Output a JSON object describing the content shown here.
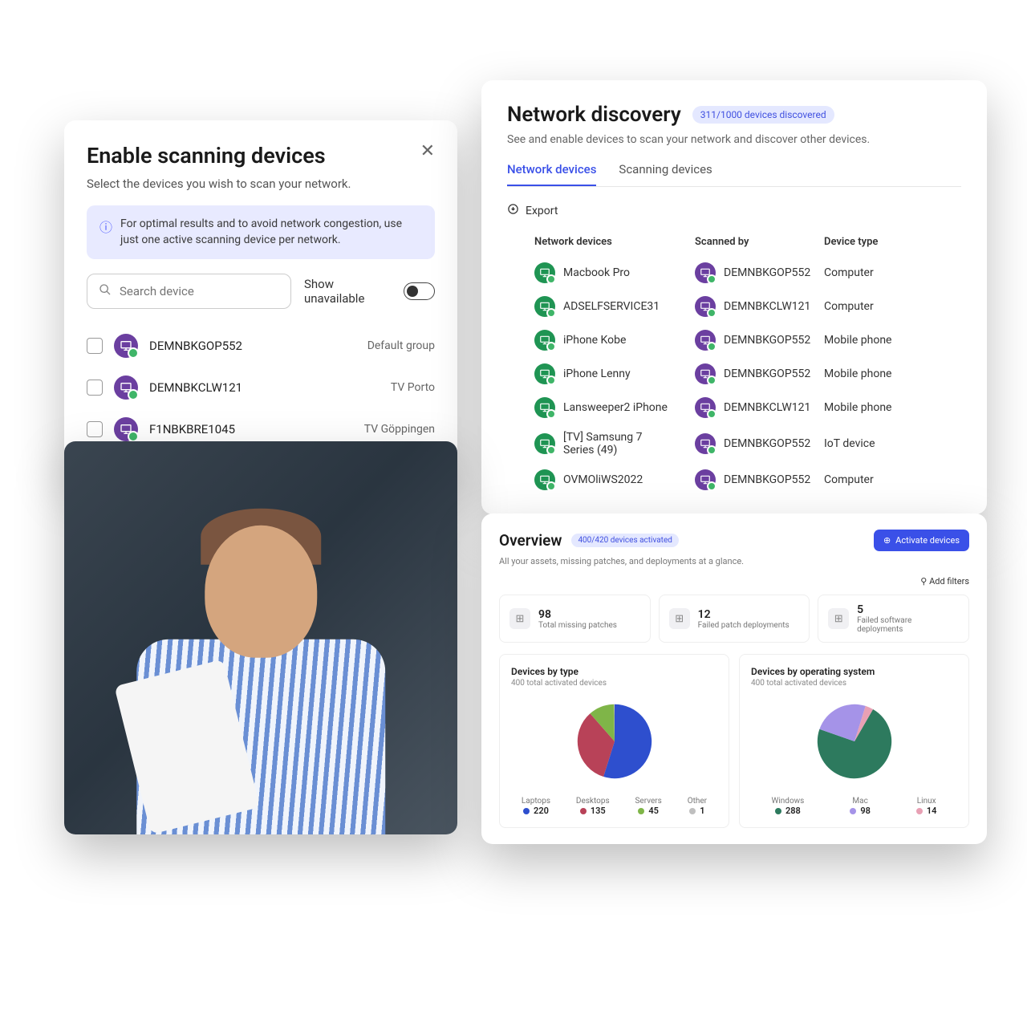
{
  "scanning": {
    "title": "Enable scanning devices",
    "subtitle": "Select the devices you wish to scan your network.",
    "info": "For optimal results and to avoid network congestion, use just one active scanning device per network.",
    "search_placeholder": "Search device",
    "show_unavailable": "Show unavailable",
    "devices": [
      {
        "name": "DEMNBKGOP552",
        "group": "Default group"
      },
      {
        "name": "DEMNBKCLW121",
        "group": "TV Porto"
      },
      {
        "name": "F1NBKBRE1045",
        "group": "TV Göppingen"
      }
    ]
  },
  "discovery": {
    "title": "Network discovery",
    "badge": "311/1000 devices discovered",
    "subtitle": "See and enable devices to scan your network and discover other devices.",
    "tabs": [
      "Network devices",
      "Scanning devices"
    ],
    "export": "Export",
    "columns": [
      "Network devices",
      "Scanned by",
      "Device type"
    ],
    "rows": [
      {
        "device": "Macbook Pro",
        "scanned": "DEMNBKGOP552",
        "type": "Computer"
      },
      {
        "device": "ADSELFSERVICE31",
        "scanned": "DEMNBKCLW121",
        "type": "Computer"
      },
      {
        "device": "iPhone Kobe",
        "scanned": "DEMNBKGOP552",
        "type": "Mobile phone"
      },
      {
        "device": "iPhone Lenny",
        "scanned": "DEMNBKGOP552",
        "type": "Mobile phone"
      },
      {
        "device": "Lansweeper2 iPhone",
        "scanned": "DEMNBKCLW121",
        "type": "Mobile phone"
      },
      {
        "device": "[TV] Samsung 7 Series (49)",
        "scanned": "DEMNBKGOP552",
        "type": "IoT device"
      },
      {
        "device": "OVMOliWS2022",
        "scanned": "DEMNBKGOP552",
        "type": "Computer"
      }
    ]
  },
  "overview": {
    "title": "Overview",
    "badge": "400/420 devices activated",
    "button": "Activate devices",
    "subtitle": "All your assets, missing patches, and deployments at a glance.",
    "filters": "Add filters",
    "stats": [
      {
        "value": "98",
        "label": "Total missing patches"
      },
      {
        "value": "12",
        "label": "Failed patch deployments"
      },
      {
        "value": "5",
        "label": "Failed software deployments"
      }
    ],
    "chart1": {
      "title": "Devices by type",
      "subtitle": "400 total activated devices",
      "items": [
        {
          "label": "Laptops",
          "value": 220,
          "color": "#2e4fce"
        },
        {
          "label": "Desktops",
          "value": 135,
          "color": "#b84258"
        },
        {
          "label": "Servers",
          "value": 45,
          "color": "#7fb548"
        },
        {
          "label": "Other",
          "value": 1,
          "color": "#bfbfbf"
        }
      ]
    },
    "chart2": {
      "title": "Devices by operating system",
      "subtitle": "400 total activated devices",
      "items": [
        {
          "label": "Windows",
          "value": 288,
          "color": "#2d7a5e"
        },
        {
          "label": "Mac",
          "value": 98,
          "color": "#a593e8"
        },
        {
          "label": "Linux",
          "value": 14,
          "color": "#e8a0b4"
        }
      ]
    }
  },
  "chart_data": [
    {
      "type": "pie",
      "title": "Devices by type",
      "subtitle": "400 total activated devices",
      "categories": [
        "Laptops",
        "Desktops",
        "Servers",
        "Other"
      ],
      "values": [
        220,
        135,
        45,
        1
      ],
      "colors": [
        "#2e4fce",
        "#b84258",
        "#7fb548",
        "#bfbfbf"
      ]
    },
    {
      "type": "pie",
      "title": "Devices by operating system",
      "subtitle": "400 total activated devices",
      "categories": [
        "Windows",
        "Mac",
        "Linux"
      ],
      "values": [
        288,
        98,
        14
      ],
      "colors": [
        "#2d7a5e",
        "#a593e8",
        "#e8a0b4"
      ]
    }
  ]
}
